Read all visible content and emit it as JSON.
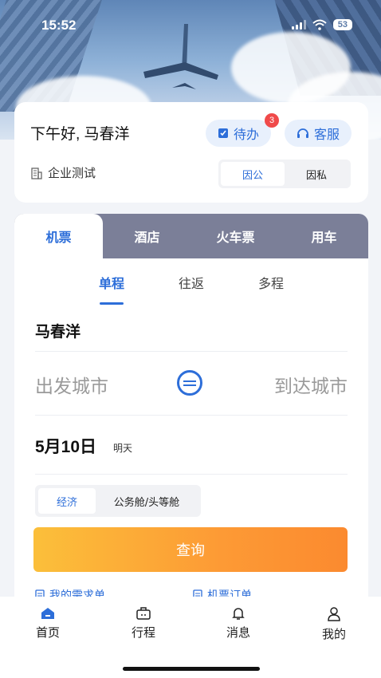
{
  "status": {
    "time": "15:52",
    "battery": "53"
  },
  "greeting": {
    "text": "下午好, 马春洋",
    "todo_label": "待办",
    "todo_badge": "3",
    "service_label": "客服",
    "company": "企业测试",
    "purpose_options": [
      "因公",
      "因私"
    ],
    "purpose_selected": "因公"
  },
  "booking": {
    "tabs": [
      "机票",
      "酒店",
      "火车票",
      "用车"
    ],
    "active_tab": "机票",
    "trip_types": [
      "单程",
      "往返",
      "多程"
    ],
    "active_trip_type": "单程",
    "passenger": "马春洋",
    "from_placeholder": "出发城市",
    "to_placeholder": "到达城市",
    "date": "5月10日",
    "date_tag": "明天",
    "cabin_options": [
      "经济",
      "公务舱/头等舱"
    ],
    "cabin_selected": "经济",
    "search_label": "查询",
    "quick_links": [
      "我的需求单",
      "机票订单"
    ]
  },
  "nav": {
    "items": [
      "首页",
      "行程",
      "消息",
      "我的"
    ],
    "active": "首页"
  },
  "colors": {
    "accent": "#2d6ed9",
    "search_start": "#fbbf3a",
    "search_end": "#fb8a2f",
    "tab_bar": "#7b7f98",
    "badge": "#f04a4a"
  },
  "icons": [
    "plane-photo",
    "signal-icon",
    "wifi-icon",
    "todo-icon",
    "headset-icon",
    "building-icon",
    "swap-icon",
    "doc-icon",
    "home-icon",
    "briefcase-icon",
    "bell-icon",
    "user-icon"
  ]
}
